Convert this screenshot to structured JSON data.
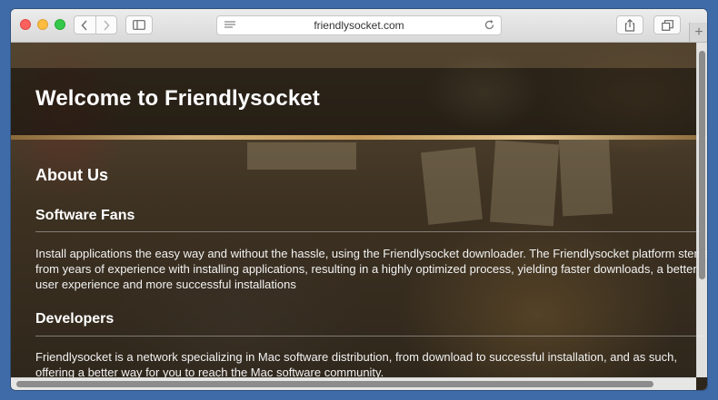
{
  "browser": {
    "address": "friendlysocket.com",
    "new_tab_label": "+"
  },
  "page": {
    "title": "Welcome to Friendlysocket",
    "section_title": "About Us",
    "subsections": [
      {
        "heading": "Software Fans",
        "lines": [
          "Install applications the easy way and without the hassle, using the Friendlysocket downloader. The Friendlysocket platform stems",
          "from years of experience with installing applications, resulting in a highly optimized process, yielding faster downloads, a better",
          "user experience and more successful installations"
        ]
      },
      {
        "heading": "Developers",
        "lines": [
          "Friendlysocket is a network specializing in Mac software distribution, from download to successful installation, and as such,",
          "offering a better way for you to reach the Mac software community."
        ]
      }
    ]
  },
  "colors": {
    "desktop": "#3f6ca8",
    "close": "#fc615d",
    "minimize": "#fdbc40",
    "zoom": "#34c84a",
    "heading_text": "#ffffff",
    "accent_rule": "#d2b07a"
  },
  "icons": [
    "close-icon",
    "minimize-icon",
    "zoom-icon",
    "back-icon",
    "forward-icon",
    "sidebar-icon",
    "reader-icon",
    "reload-icon",
    "share-icon",
    "tabs-icon",
    "plus-icon"
  ]
}
